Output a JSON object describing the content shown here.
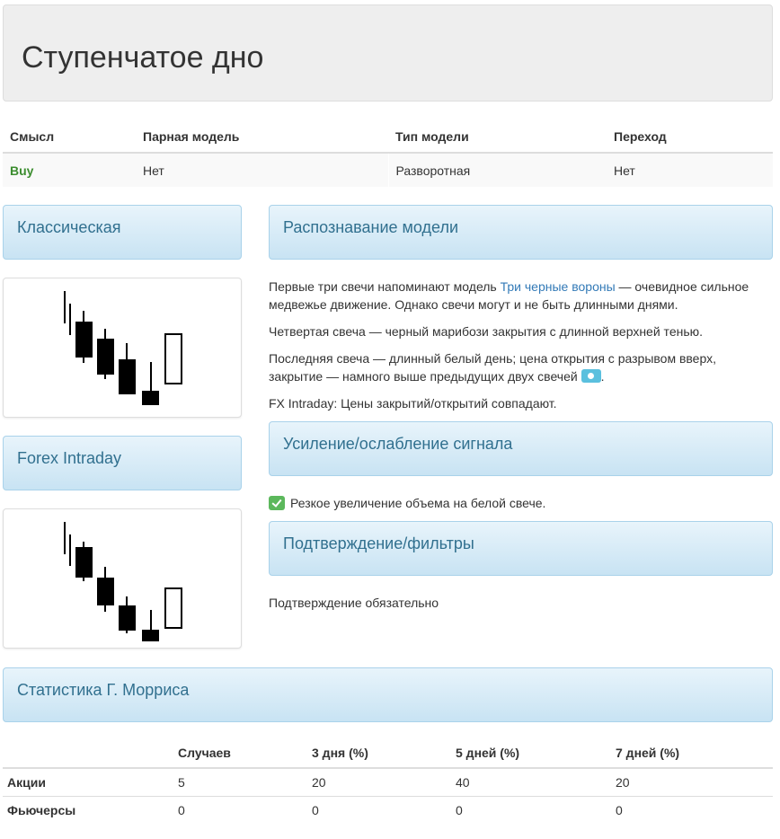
{
  "page": {
    "title": "Ступенчатое дно"
  },
  "info_table": {
    "headers": [
      "Смысл",
      "Парная модель",
      "Тип модели",
      "Переход"
    ],
    "row": [
      "Buy",
      "Нет",
      "Разворотная",
      "Нет"
    ]
  },
  "panels": {
    "classic": "Классическая",
    "forex": "Forex Intraday",
    "recognition": "Распознавание модели",
    "signal": "Усиление/ослабление сигнала",
    "confirmation": "Подтверждение/фильтры",
    "stats": "Статистика Г. Морриса"
  },
  "recognition": {
    "p1_before": "Первые три свечи напоминают модель ",
    "p1_link": "Три черные вороны",
    "p1_after": " — очевидное сильное медвежье движение. Однако свечи могут и не быть длинными днями.",
    "p2": "Четвертая свеча — черный марибози закрытия с длинной верхней тенью.",
    "p3": "Последняя свеча — длинный белый день; цена открытия с разрывом вверх, закрытие — намного выше предыдущих двух свечей",
    "p3_end": ".",
    "p4": "FX Intraday: Цены закрытий/открытий совпадают."
  },
  "signal": {
    "item": "Резкое увеличение объема на белой свече."
  },
  "confirmation": {
    "text": "Подтверждение обязательно"
  },
  "stats_table": {
    "headers": [
      "",
      "Случаев",
      "3 дня (%)",
      "5 дней (%)",
      "7 дней (%)"
    ],
    "rows": [
      [
        "Акции",
        "5",
        "20",
        "40",
        "20"
      ],
      [
        "Фьючерсы",
        "0",
        "0",
        "0",
        "0"
      ]
    ]
  },
  "colors": {
    "buy": "#3c8d2f",
    "link": "#337ab7",
    "panel_title": "#31708f"
  },
  "icons": {
    "info": "info-icon",
    "check": "check-icon"
  }
}
